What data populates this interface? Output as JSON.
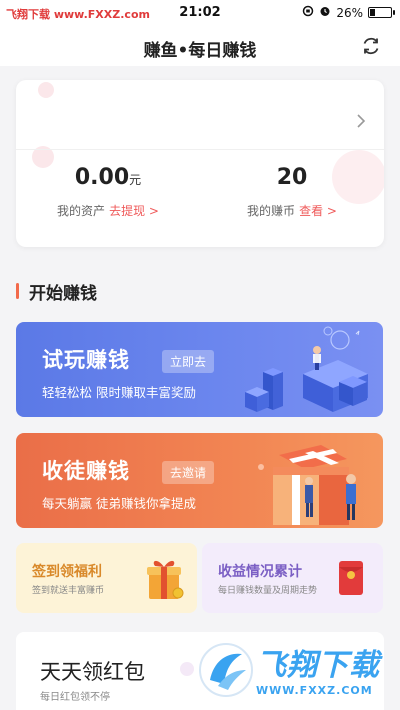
{
  "status_bar": {
    "left_text": "飞翔下载 www.FXXZ.com",
    "time": "21:02",
    "battery": "26%",
    "battery_level": 0.26
  },
  "header": {
    "title": "赚鱼•每日赚钱"
  },
  "assets": {
    "balance_value": "0.00",
    "balance_unit": "元",
    "balance_label": "我的资产",
    "withdraw_link": "去提现 >",
    "coins_value": "20",
    "coins_label": "我的赚币",
    "view_link": "查看 >"
  },
  "section": {
    "title": "开始赚钱"
  },
  "banners": [
    {
      "title": "试玩赚钱",
      "button": "立即去",
      "subtitle": "轻轻松松 限时赚取丰富奖励"
    },
    {
      "title": "收徒赚钱",
      "button": "去邀请",
      "subtitle": "每天躺赢 徒弟赚钱你拿提成"
    }
  ],
  "mini_cards": [
    {
      "title": "签到领福利",
      "subtitle": "签到就送丰富赚币",
      "icon": "gift-box-icon"
    },
    {
      "title": "收益情况累计",
      "subtitle": "每日赚钱数量及周期走势",
      "icon": "red-envelope-icon"
    }
  ],
  "red_packet": {
    "title": "天天领红包",
    "subtitle": "每日红包领不停"
  },
  "watermark": {
    "title": "飞翔下载",
    "url": "WWW.FXXZ.COM"
  },
  "colors": {
    "accent_red": "#ef5a5a",
    "blue_banner": "#5b79e6",
    "orange_banner": "#ea6e48",
    "section_bar": "#f26a4b"
  }
}
